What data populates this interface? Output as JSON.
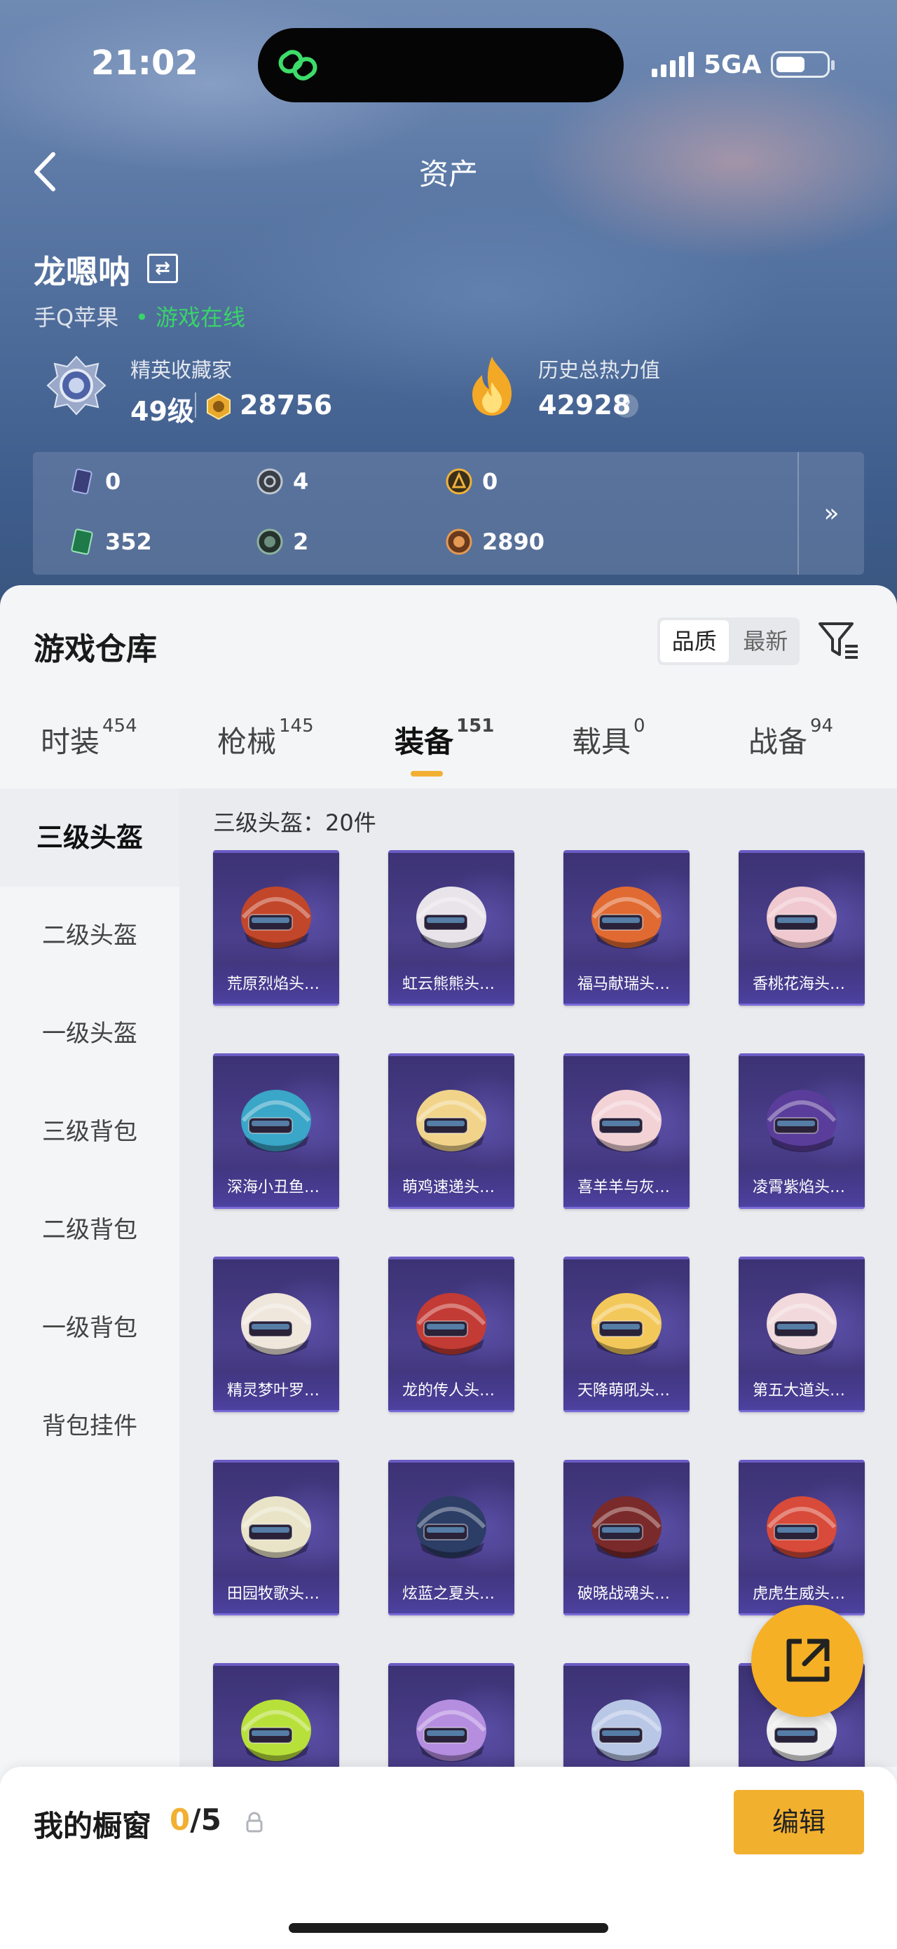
{
  "status_bar": {
    "time": "21:02",
    "network": "5GA"
  },
  "header": {
    "title": "资产"
  },
  "profile": {
    "name": "龙嗯呐",
    "platform": "手Q苹果",
    "online_status": "• 游戏在线",
    "collector_title": "精英收藏家",
    "level": "49级",
    "collector_points": "28756",
    "heat_label": "历史总热力值",
    "heat_value": "42928",
    "help_symbol": "?"
  },
  "currencies": [
    {
      "icon": "card-icon",
      "value": "0"
    },
    {
      "icon": "silver-coin-icon",
      "value": "4"
    },
    {
      "icon": "gold-coin-icon",
      "value": "0"
    },
    {
      "icon": "green-ticket-icon",
      "value": "352"
    },
    {
      "icon": "dark-orb-icon",
      "value": "2"
    },
    {
      "icon": "bronze-coin-icon",
      "value": "2890"
    }
  ],
  "currency_more": "»",
  "warehouse": {
    "title": "游戏仓库",
    "sort_options": [
      "品质",
      "最新"
    ],
    "sort_selected": "品质"
  },
  "tabs": [
    {
      "label": "时装",
      "count": "454"
    },
    {
      "label": "枪械",
      "count": "145"
    },
    {
      "label": "装备",
      "count": "151"
    },
    {
      "label": "载具",
      "count": "0"
    },
    {
      "label": "战备",
      "count": "94"
    }
  ],
  "active_tab": "装备",
  "side_menu": [
    "三级头盔",
    "二级头盔",
    "一级头盔",
    "三级背包",
    "二级背包",
    "一级背包",
    "背包挂件"
  ],
  "grid": {
    "caption": "三级头盔：20件",
    "items": [
      "荒原烈焰头…",
      "虹云熊熊头…",
      "福马献瑞头…",
      "香桃花海头…",
      "深海小丑鱼…",
      "萌鸡速递头…",
      "喜羊羊与灰…",
      "凌霄紫焰头…",
      "精灵梦叶罗…",
      "龙的传人头…",
      "天降萌吼头…",
      "第五大道头…",
      "田园牧歌头…",
      "炫蓝之夏头…",
      "破晓战魂头…",
      "虎虎生威头…",
      "",
      "",
      "",
      ""
    ],
    "colors": [
      "#c2462a",
      "#e9e4ea",
      "#e06a32",
      "#f0c8cf",
      "#3aa6c8",
      "#f1d48a",
      "#f3d2d6",
      "#5a3d9a",
      "#efe6dc",
      "#c33b35",
      "#f3c85a",
      "#f1d9dc",
      "#e9e4c8",
      "#2c3d66",
      "#7a2a2a",
      "#d84a3a",
      "#b8e03a",
      "#b58ee0",
      "#b9c7e6",
      "#eeeeee"
    ]
  },
  "showcase": {
    "title": "我的橱窗",
    "current": "0",
    "total": "/5",
    "edit_label": "编辑"
  }
}
